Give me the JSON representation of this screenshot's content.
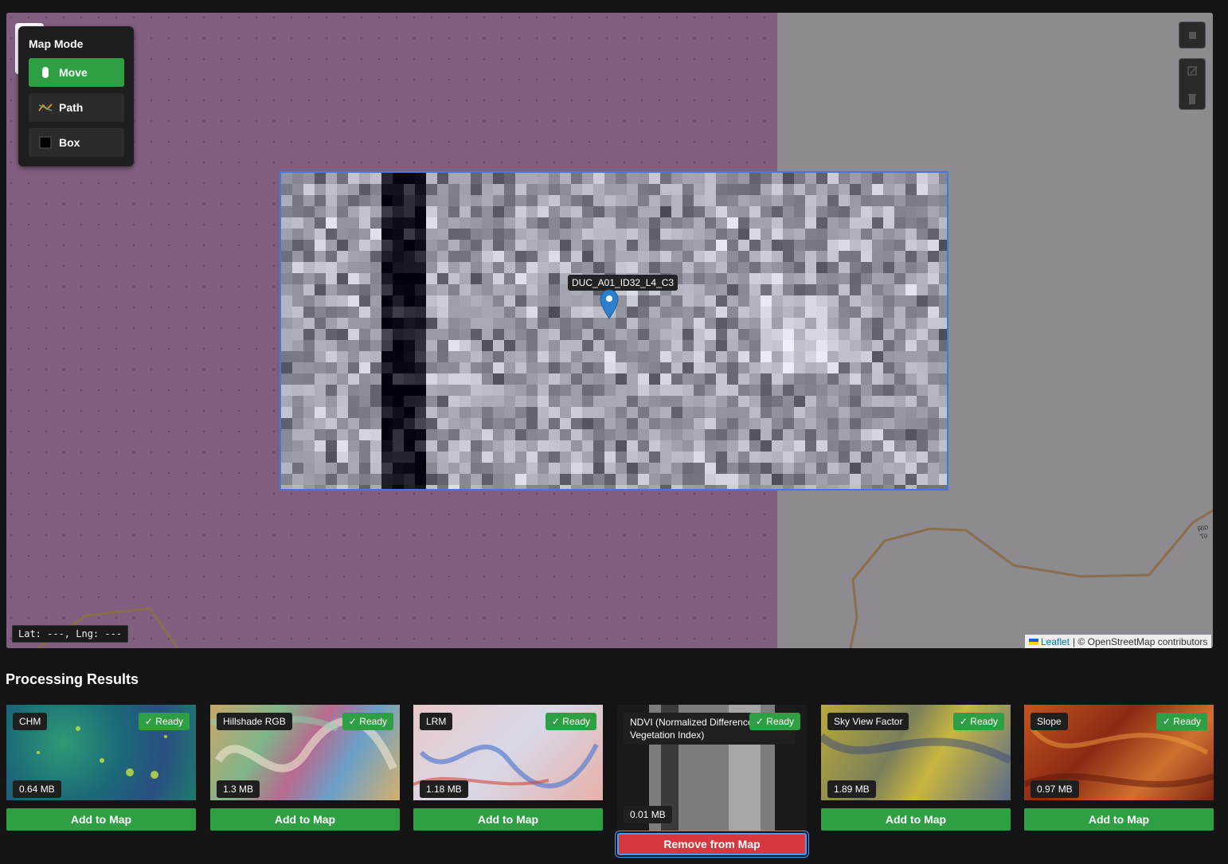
{
  "map": {
    "mode_panel": {
      "title": "Map Mode",
      "modes": [
        {
          "label": "Move",
          "icon": "mouse-icon",
          "active": true
        },
        {
          "label": "Path",
          "icon": "path-icon",
          "active": false
        },
        {
          "label": "Box",
          "icon": "box-icon",
          "active": false
        }
      ]
    },
    "marker_label": "DUC_A01_ID32_L4_C3",
    "coords": "Lat: ---, Lng: ---",
    "attribution": {
      "link": "Leaflet",
      "text": "| © OpenStreetMap contributors"
    },
    "road_label": "Rio To"
  },
  "results": {
    "title": "Processing Results",
    "cards": [
      {
        "name": "CHM",
        "status": "✓ Ready",
        "size": "0.64 MB",
        "action": "Add to Map"
      },
      {
        "name": "Hillshade RGB",
        "status": "✓ Ready",
        "size": "1.3 MB",
        "action": "Add to Map"
      },
      {
        "name": "LRM",
        "status": "✓ Ready",
        "size": "1.18 MB",
        "action": "Add to Map"
      },
      {
        "name": "NDVI (Normalized Difference Vegetation Index)",
        "status": "✓ Ready",
        "size": "0.01 MB",
        "action": "Remove from Map"
      },
      {
        "name": "Sky View Factor",
        "status": "✓ Ready",
        "size": "1.89 MB",
        "action": "Add to Map"
      },
      {
        "name": "Slope",
        "status": "✓ Ready",
        "size": "0.97 MB",
        "action": "Add to Map"
      }
    ]
  }
}
